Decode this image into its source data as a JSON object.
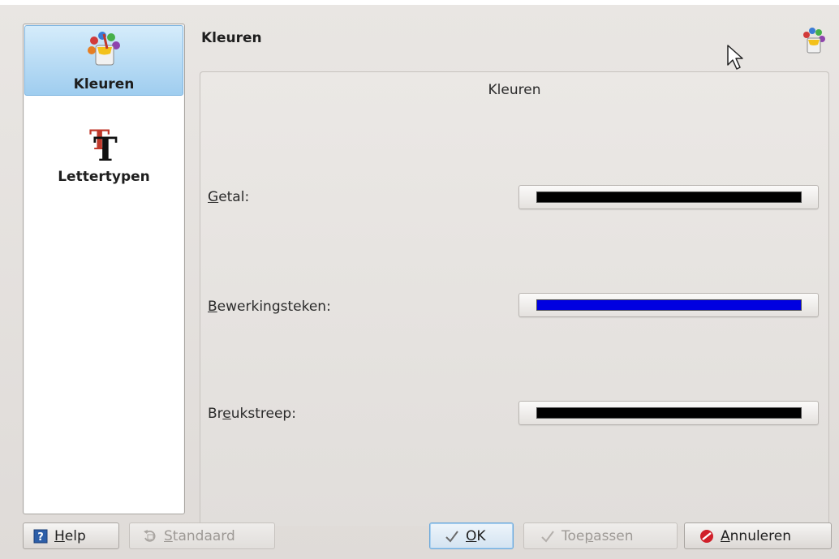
{
  "sidebar": {
    "items": [
      {
        "label": "Kleuren",
        "icon": "colors-icon",
        "selected": true
      },
      {
        "label": "Lettertypen",
        "icon": "fonts-icon",
        "selected": false
      }
    ]
  },
  "header": {
    "title": "Kleuren",
    "icon": "colors-icon"
  },
  "group": {
    "title": "Kleuren",
    "rows": [
      {
        "label_mnemonic": "G",
        "label_rest": "etal:",
        "color": "#000000"
      },
      {
        "label_mnemonic": "B",
        "label_rest": "ewerkingsteken:",
        "color": "#0000e0"
      },
      {
        "label_pre": "Br",
        "label_mnemonic": "e",
        "label_rest": "ukstreep:",
        "color": "#000000"
      }
    ]
  },
  "buttons": {
    "help": {
      "mnemonic": "H",
      "rest": "elp",
      "icon": "help-icon"
    },
    "defaults": {
      "mnemonic": "S",
      "rest": "tandaard",
      "icon": "reset-icon",
      "enabled": false
    },
    "ok": {
      "mnemonic": "O",
      "rest": "K",
      "icon": "checkmark-icon"
    },
    "apply": {
      "pre": "Toe",
      "mnemonic": "p",
      "rest": "assen",
      "icon": "checkmark-icon",
      "enabled": false
    },
    "cancel": {
      "mnemonic": "A",
      "rest": "nnuleren",
      "icon": "cancel-icon"
    }
  }
}
